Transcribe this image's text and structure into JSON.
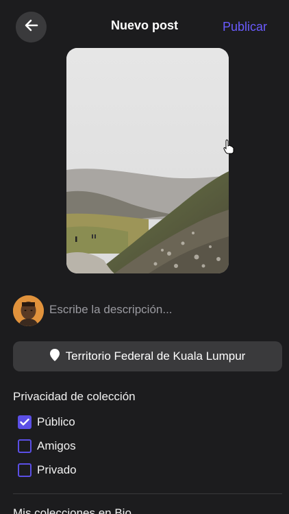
{
  "header": {
    "title": "Nuevo post",
    "publish_label": "Publicar"
  },
  "description": {
    "placeholder": "Escribe la descripción..."
  },
  "location": {
    "label": "Territorio Federal de Kuala Lumpur"
  },
  "privacy": {
    "title": "Privacidad de colección",
    "options": [
      {
        "label": "Público",
        "checked": true
      },
      {
        "label": "Amigos",
        "checked": false
      },
      {
        "label": "Privado",
        "checked": false
      }
    ]
  },
  "collections": {
    "title": "Mis colecciones en Bio"
  },
  "colors": {
    "background": "#1c1c1e",
    "accent": "#6a5bff",
    "surface": "#3a3a3c"
  }
}
